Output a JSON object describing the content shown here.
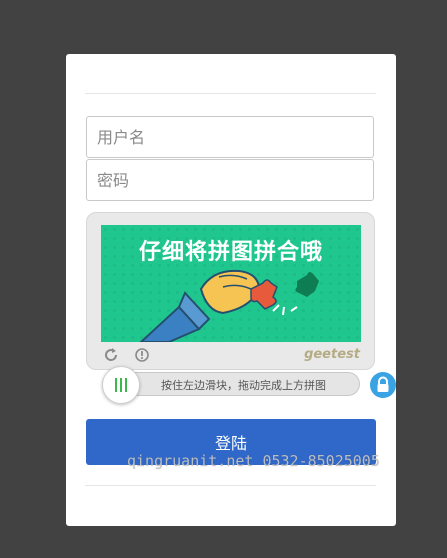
{
  "form": {
    "username_placeholder": "用户名",
    "password_placeholder": "密码",
    "submit_label": "登陆"
  },
  "captcha": {
    "puzzle_title": "仔细将拼图拼合哦",
    "brand": "geetest",
    "slider_hint": "按住左边滑块，拖动完成上方拼图",
    "icons": [
      "refresh-icon",
      "info-icon",
      "slider-handle-icon",
      "lock-icon"
    ]
  },
  "watermark": "qingruanit.net 0532-85025005",
  "colors": {
    "background": "#424242",
    "puzzle_green": "#1fc78f",
    "button_blue": "#3068c9",
    "lock_blue": "#3aa3e3",
    "knob_green": "#3db84b"
  }
}
